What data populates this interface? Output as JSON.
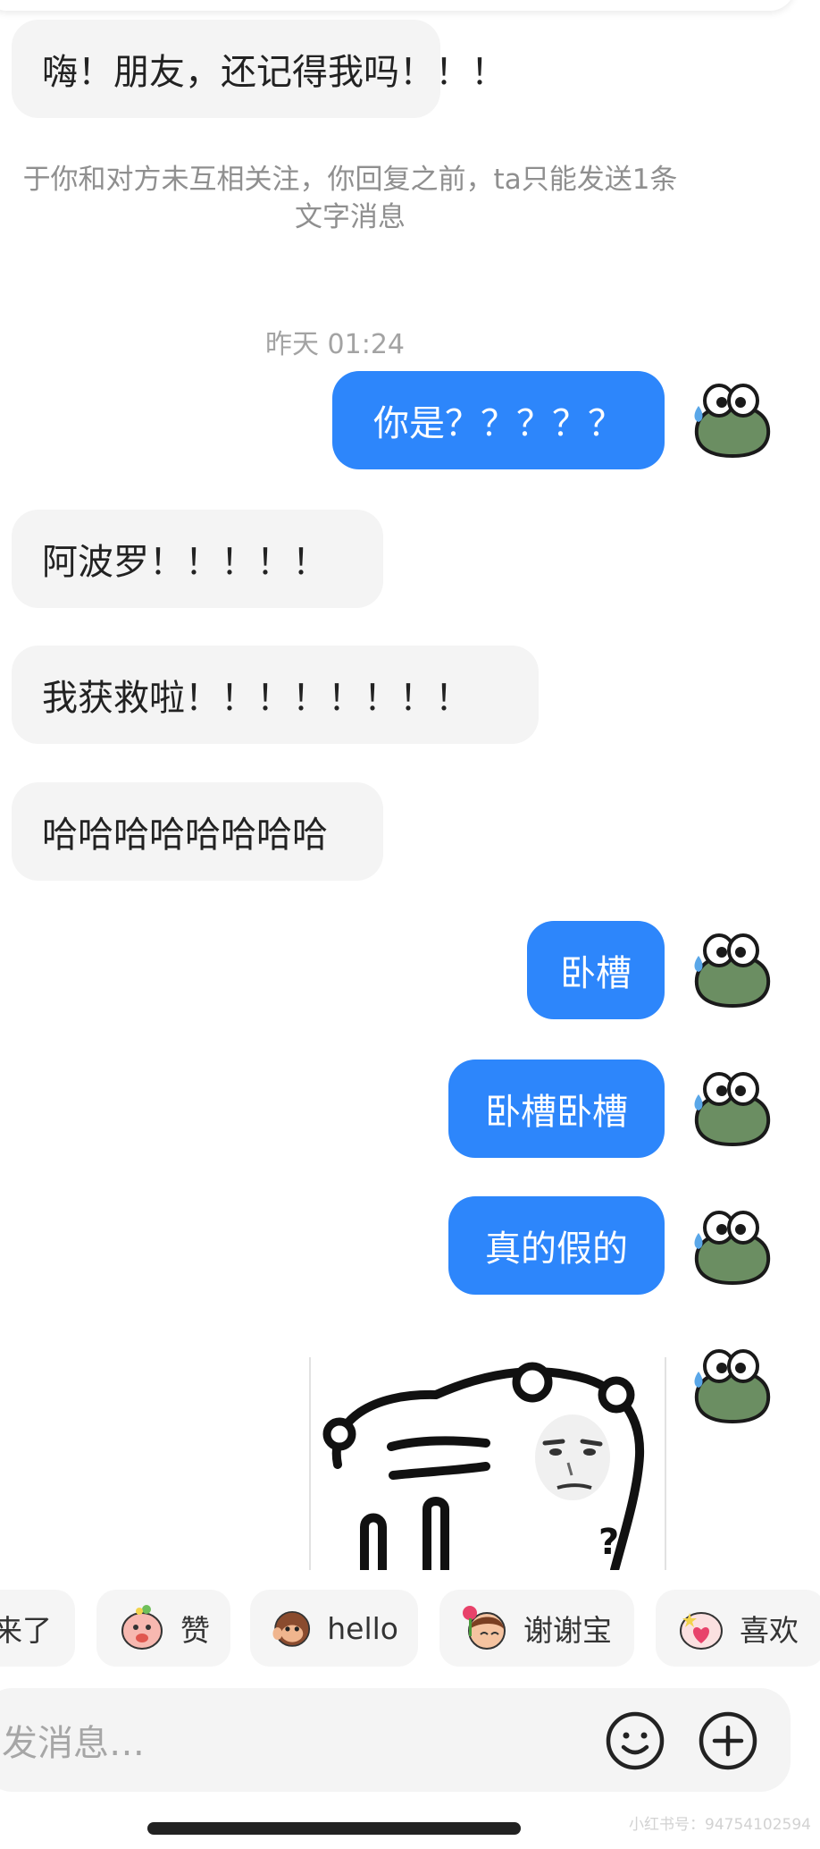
{
  "chat": {
    "messages": [
      {
        "side": "left",
        "text": "嗨！朋友，还记得我吗！！！"
      },
      {
        "side": "right",
        "text": "你是？？？？？"
      },
      {
        "side": "left",
        "text": "阿波罗！！！！！"
      },
      {
        "side": "left",
        "text": "我获救啦！！！！！！！！"
      },
      {
        "side": "left",
        "text": "哈哈哈哈哈哈哈哈"
      },
      {
        "side": "right",
        "text": "卧槽"
      },
      {
        "side": "right",
        "text": "卧槽卧槽"
      },
      {
        "side": "right",
        "text": "真的假的"
      }
    ],
    "notice_line1": "于你和对方未互相关注，你回复之前，ta只能发送1条",
    "notice_line2": "文字消息",
    "timestamp": "昨天 01:24",
    "sticker_caption": "?"
  },
  "quick_replies": [
    {
      "label": "来了",
      "emoji": "none"
    },
    {
      "label": "赞",
      "emoji": "thumbs-up-face-emoji"
    },
    {
      "label": "hello",
      "emoji": "monkey-wave-emoji"
    },
    {
      "label": "谢谢宝",
      "emoji": "flower-girl-emoji"
    },
    {
      "label": "喜欢",
      "emoji": "heart-face-emoji"
    }
  ],
  "input": {
    "placeholder": "发消息…"
  },
  "watermark": "小红书号：94754102594",
  "colors": {
    "outgoing_bubble": "#2d86fb",
    "incoming_bubble": "#f4f4f4",
    "avatar_green": "#6b8e62"
  }
}
